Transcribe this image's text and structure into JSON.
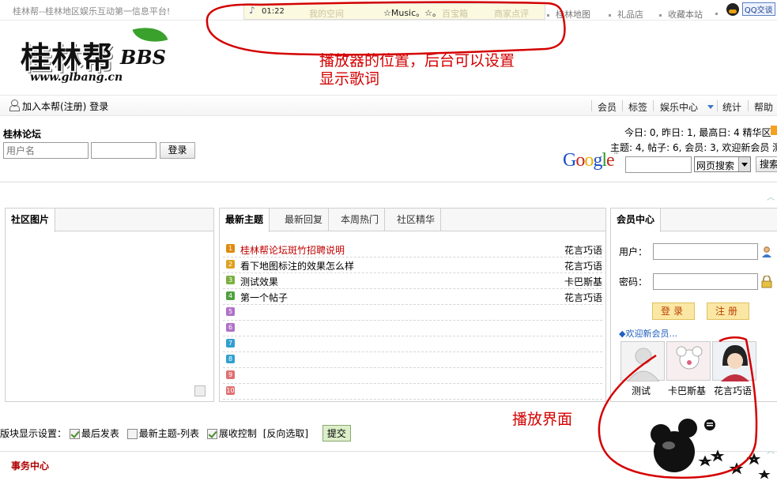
{
  "top": {
    "slogan": "桂林帮--桂林地区娱乐互动第一信息平台!",
    "links": [
      "桂林地图",
      "礼品店",
      "收藏本站"
    ],
    "qq_button": "QQ交谈"
  },
  "player": {
    "time": "01:22",
    "title": "☆Music。☆。",
    "ghost_links": [
      "我的空间",
      "百宝箱",
      "商家点评"
    ]
  },
  "logo": {
    "name": "桂林帮",
    "suffix": "BBS",
    "url": "www.glbang.cn"
  },
  "annotations": {
    "player_position_line1": "播放器的位置，后台可以设置",
    "player_position_line2": "显示歌词",
    "player_ui": "播放界面"
  },
  "nav": {
    "join": "加入本帮(注册)",
    "login": "登录",
    "items": [
      "会员",
      "标签",
      "娱乐中心",
      "统计",
      "帮助"
    ]
  },
  "login": {
    "forum_title": "桂林论坛",
    "username_placeholder": "用户名",
    "button": "登录"
  },
  "stats": {
    "line1": "今日: 0, 昨日: 1, 最高日: 4   精华区",
    "line2": "主题: 4, 帖子: 6, 会员: 3, 欢迎新会员 测"
  },
  "search": {
    "engine": "Google",
    "select_value": "网页搜索",
    "button": "搜索"
  },
  "panels": {
    "pictures": {
      "title": "社区图片"
    },
    "topics": {
      "tabs": [
        "最新主题",
        "最新回复",
        "本周热门",
        "社区精华"
      ],
      "rows": [
        {
          "num": "1",
          "title": "桂林帮论坛斑竹招聘说明",
          "author": "花言巧语",
          "color": "#e08a10",
          "title_color": "#c00000"
        },
        {
          "num": "2",
          "title": "看下地图标注的效果怎么样",
          "author": "花言巧语",
          "color": "#e0a020",
          "title_color": "#000000"
        },
        {
          "num": "3",
          "title": "测试效果",
          "author": "卡巴斯基",
          "color": "#7ab040",
          "title_color": "#000000"
        },
        {
          "num": "4",
          "title": "第一个帖子",
          "author": "花言巧语",
          "color": "#50a040",
          "title_color": "#000000"
        },
        {
          "num": "5",
          "title": "",
          "author": "",
          "color": "#b070c8",
          "title_color": "#000000"
        },
        {
          "num": "6",
          "title": "",
          "author": "",
          "color": "#b070c8",
          "title_color": "#000000"
        },
        {
          "num": "7",
          "title": "",
          "author": "",
          "color": "#30a0d0",
          "title_color": "#000000"
        },
        {
          "num": "8",
          "title": "",
          "author": "",
          "color": "#30a0d0",
          "title_color": "#000000"
        },
        {
          "num": "9",
          "title": "",
          "author": "",
          "color": "#e07070",
          "title_color": "#000000"
        },
        {
          "num": "10",
          "title": "",
          "author": "",
          "color": "#e07070",
          "title_color": "#000000"
        }
      ]
    },
    "member": {
      "title": "会员中心",
      "user_label": "用户：",
      "pass_label": "密码：",
      "login_btn": "登录",
      "register_btn": "注册",
      "welcome": "欢迎新会员...",
      "new_members": [
        "测试",
        "卡巴斯基",
        "花言巧语"
      ]
    }
  },
  "settings": {
    "label": "版块显示设置：",
    "options": [
      {
        "label": "最后发表",
        "checked": true
      },
      {
        "label": "最新主题-列表",
        "checked": false
      },
      {
        "label": "展收控制",
        "checked": true
      }
    ],
    "invert": "[反向选取]",
    "submit": "提交"
  },
  "footer": {
    "affairs": "事务中心"
  },
  "colors": {
    "annotation": "#d40000",
    "accent": "#2060c0"
  }
}
